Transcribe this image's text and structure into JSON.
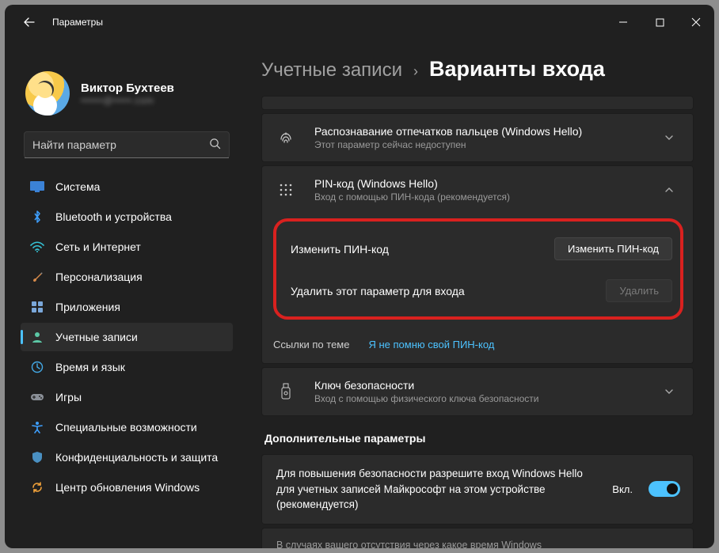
{
  "window": {
    "title": "Параметры"
  },
  "account": {
    "name": "Виктор Бухтеев",
    "email": "••••••@•••••.com"
  },
  "search": {
    "placeholder": "Найти параметр"
  },
  "sidebar": {
    "items": [
      {
        "label": "Система"
      },
      {
        "label": "Bluetooth и устройства"
      },
      {
        "label": "Сеть и Интернет"
      },
      {
        "label": "Персонализация"
      },
      {
        "label": "Приложения"
      },
      {
        "label": "Учетные записи"
      },
      {
        "label": "Время и язык"
      },
      {
        "label": "Игры"
      },
      {
        "label": "Специальные возможности"
      },
      {
        "label": "Конфиденциальность и защита"
      },
      {
        "label": "Центр обновления Windows"
      }
    ]
  },
  "breadcrumb": {
    "parent": "Учетные записи",
    "sep": "›",
    "current": "Варианты входа"
  },
  "options": {
    "fingerprint": {
      "title": "Распознавание отпечатков пальцев (Windows Hello)",
      "sub": "Этот параметр сейчас недоступен"
    },
    "pin": {
      "title": "PIN-код (Windows Hello)",
      "sub": "Вход с помощью ПИН-кода (рекомендуется)",
      "change_label": "Изменить ПИН-код",
      "change_button": "Изменить ПИН-код",
      "remove_label": "Удалить этот параметр для входа",
      "remove_button": "Удалить",
      "links_title": "Ссылки по теме",
      "forgot_link": "Я не помню свой ПИН-код"
    },
    "securitykey": {
      "title": "Ключ безопасности",
      "sub": "Вход с помощью физического ключа безопасности"
    }
  },
  "extras": {
    "section_title": "Дополнительные параметры",
    "hello_ms": {
      "text": "Для повышения безопасности разрешите вход Windows Hello для учетных записей Майкрософт на этом устройстве (рекомендуется)",
      "state": "Вкл."
    },
    "absence_partial": "В случаях вашего отсутствия через какое время Windows"
  }
}
